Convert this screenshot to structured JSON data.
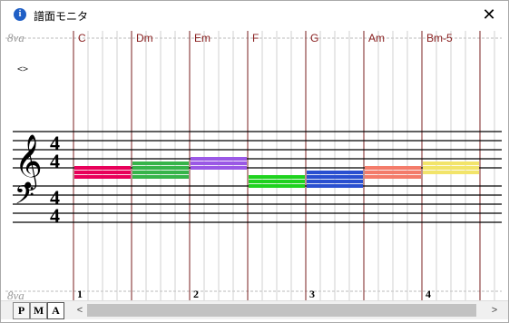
{
  "window": {
    "title": "譜面モニタ",
    "close_glyph": "✕",
    "info_icon_glyph": "i"
  },
  "score": {
    "octave_top_label": "8va",
    "octave_bottom_label": "8va",
    "toggle_label": "<>",
    "time_signature": {
      "numerator": "4",
      "denominator": "4"
    },
    "chords": [
      {
        "name": "C",
        "color": "#e8005a",
        "notes": [
          2,
          1,
          0
        ]
      },
      {
        "name": "Dm",
        "color": "#37b44a",
        "notes": [
          3,
          2,
          1,
          0
        ]
      },
      {
        "name": "Em",
        "color": "#9b59e6",
        "notes": [
          4,
          3,
          2
        ]
      },
      {
        "name": "F",
        "color": "#1fd31f",
        "notes": [
          0,
          -1,
          -2
        ]
      },
      {
        "name": "G",
        "color": "#2a4fd0",
        "notes": [
          1,
          0,
          -1,
          -2
        ]
      },
      {
        "name": "Am",
        "color": "#f47c6a",
        "notes": [
          2,
          1,
          0
        ]
      },
      {
        "name": "Bm-5",
        "color": "#f2e46a",
        "notes": [
          3,
          2,
          1
        ]
      }
    ],
    "measure_numbers": [
      "1",
      "2",
      "3",
      "4"
    ]
  },
  "bottom_bar": {
    "mode_buttons": [
      {
        "label": "P",
        "active": false
      },
      {
        "label": "M",
        "active": false
      },
      {
        "label": "A",
        "active": true
      }
    ],
    "scroll_left_glyph": "<",
    "scroll_right_glyph": ">",
    "scroll_position": 0.0,
    "scroll_visible_fraction": 0.98
  }
}
